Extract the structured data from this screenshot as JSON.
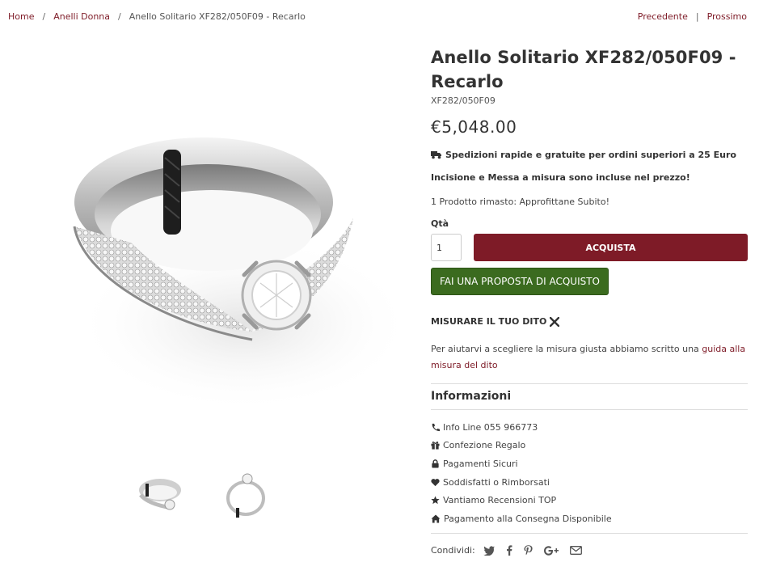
{
  "breadcrumb": {
    "items": [
      "Home",
      "Anelli Donna"
    ],
    "current": "Anello Solitario XF282/050F09 - Recarlo",
    "separator": "/"
  },
  "pager": {
    "prev": "Precedente",
    "next": "Prossimo",
    "separator": "|"
  },
  "product": {
    "title": "Anello Solitario XF282/050F09 - Recarlo",
    "sku": "XF282/050F09",
    "price": "€5,048.00",
    "shipping": "Spedizioni rapide e gratuite per ordini superiori a 25 Euro",
    "engraving": "Incisione e Messa a misura sono incluse nel prezzo!",
    "stock": "1 Prodotto rimasto: Approfittane Subito!",
    "qty_label": "Qtà",
    "qty_value": "1",
    "buy_label": "ACQUISTA",
    "offer_label": "FAI UNA PROPOSTA DI ACQUISTO"
  },
  "measure": {
    "heading": "MISURARE IL TUO DITO",
    "text": "Per aiutarvi a scegliere la misura giusta abbiamo scritto una ",
    "link": "guida alla misura del dito"
  },
  "informazioni": {
    "title": "Informazioni",
    "items": [
      {
        "icon": "phone-icon",
        "label": "Info Line 055 966773"
      },
      {
        "icon": "gift-icon",
        "label": "Confezione Regalo"
      },
      {
        "icon": "lock-icon",
        "label": "Pagamenti Sicuri"
      },
      {
        "icon": "heart-icon",
        "label": "Soddisfatti o Rimborsati"
      },
      {
        "icon": "star-icon",
        "label": "Vantiamo Recensioni TOP"
      },
      {
        "icon": "home-icon",
        "label": "Pagamento alla Consegna Disponibile"
      }
    ]
  },
  "share": {
    "label": "Condividi:",
    "icons": [
      "twitter-icon",
      "facebook-icon",
      "pinterest-icon",
      "google-plus-icon",
      "email-icon"
    ]
  },
  "colors": {
    "brand": "#7e1b27",
    "offer": "#3b6b1f",
    "text": "#333333"
  }
}
